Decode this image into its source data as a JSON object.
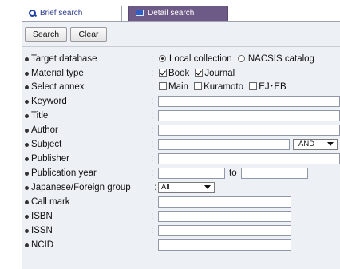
{
  "tabs": [
    {
      "label": "Brief search",
      "icon": "search-icon"
    },
    {
      "label": "Detail search",
      "icon": "detail-search-icon"
    }
  ],
  "toolbar": {
    "search_label": "Search",
    "clear_label": "Clear"
  },
  "fields": {
    "target_database": {
      "label": "Target database",
      "options": [
        "Local collection",
        "NACSIS catalog"
      ],
      "selected": "Local collection"
    },
    "material_type": {
      "label": "Material type",
      "options": [
        "Book",
        "Journal"
      ],
      "checked": [
        "Book",
        "Journal"
      ]
    },
    "select_annex": {
      "label": "Select annex",
      "options": [
        "Main",
        "Kuramoto",
        "EJ･EB"
      ],
      "checked": []
    },
    "keyword": {
      "label": "Keyword",
      "value": ""
    },
    "title": {
      "label": "Title",
      "value": ""
    },
    "author": {
      "label": "Author",
      "value": ""
    },
    "subject": {
      "label": "Subject",
      "value": "",
      "operator": "AND"
    },
    "publisher": {
      "label": "Publisher",
      "value": ""
    },
    "publication_year": {
      "label": "Publication year",
      "from": "",
      "to_label": "to",
      "to": ""
    },
    "japanese_foreign_group": {
      "label": "Japanese/Foreign group",
      "selected": "All"
    },
    "call_mark": {
      "label": "Call mark",
      "value": ""
    },
    "isbn": {
      "label": "ISBN",
      "value": ""
    },
    "issn": {
      "label": "ISSN",
      "value": ""
    },
    "ncid": {
      "label": "NCID",
      "value": ""
    }
  },
  "colon": ":"
}
